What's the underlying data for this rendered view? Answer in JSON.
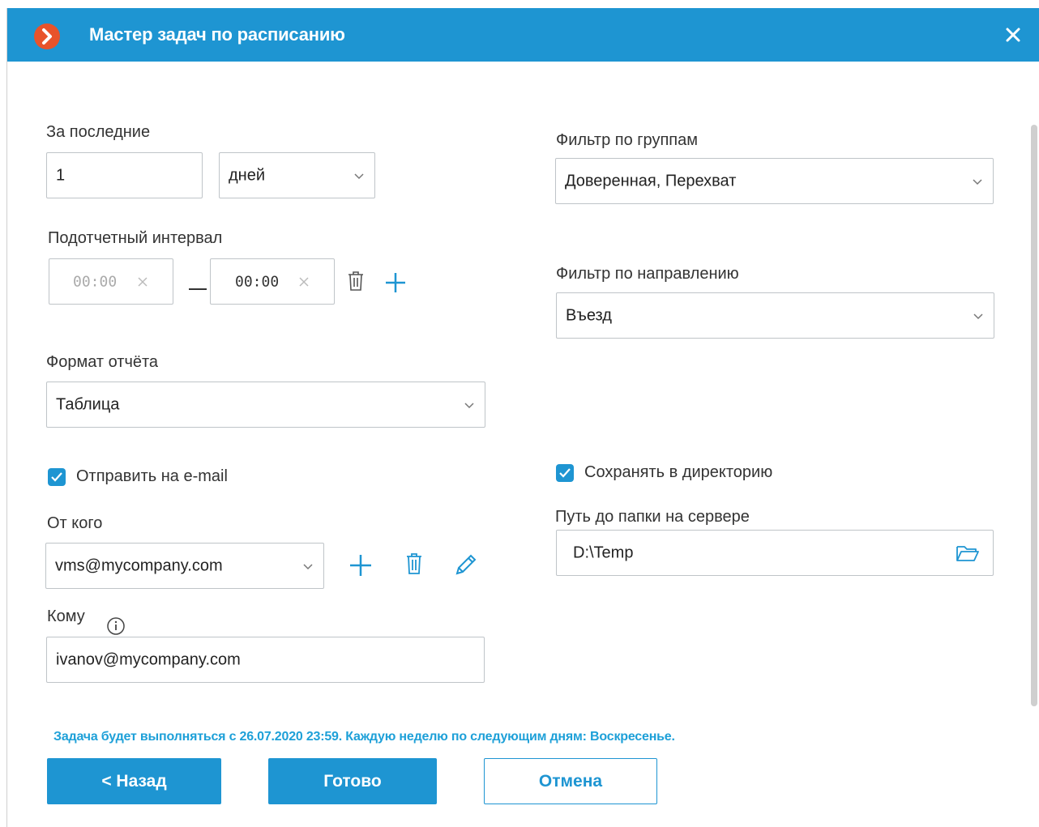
{
  "window": {
    "title": "Мастер задач по расписанию",
    "accent_color": "#1e95d2",
    "logo_color": "#e8532b",
    "close_icon": "close-icon"
  },
  "form": {
    "last_period": {
      "label": "За последние",
      "value": "1",
      "unit": "дней"
    },
    "interval": {
      "label": "Подотчетный интервал",
      "from": "00:00",
      "to": "00:00"
    },
    "format": {
      "label": "Формат отчёта",
      "value": "Таблица"
    },
    "group_filter": {
      "label": "Фильтр по группам",
      "value": "Доверенная, Перехват"
    },
    "direction_filter": {
      "label": "Фильтр по направлению",
      "value": "Въезд"
    },
    "email": {
      "checkbox_label": "Отправить на e-mail",
      "checked": true,
      "from_label": "От кого",
      "from_value": "vms@mycompany.com",
      "to_label": "Кому",
      "to_value": "ivanov@mycompany.com"
    },
    "directory": {
      "checkbox_label": "Сохранять в директорию",
      "checked": true,
      "path_label": "Путь до папки на сервере",
      "path_value": "D:\\Temp"
    }
  },
  "schedule_text": "Задача будет выполняться с 26.07.2020 23:59. Каждую неделю по следующим дням: Воскресенье.",
  "buttons": {
    "back": "< Назад",
    "done": "Готово",
    "cancel": "Отмена"
  }
}
